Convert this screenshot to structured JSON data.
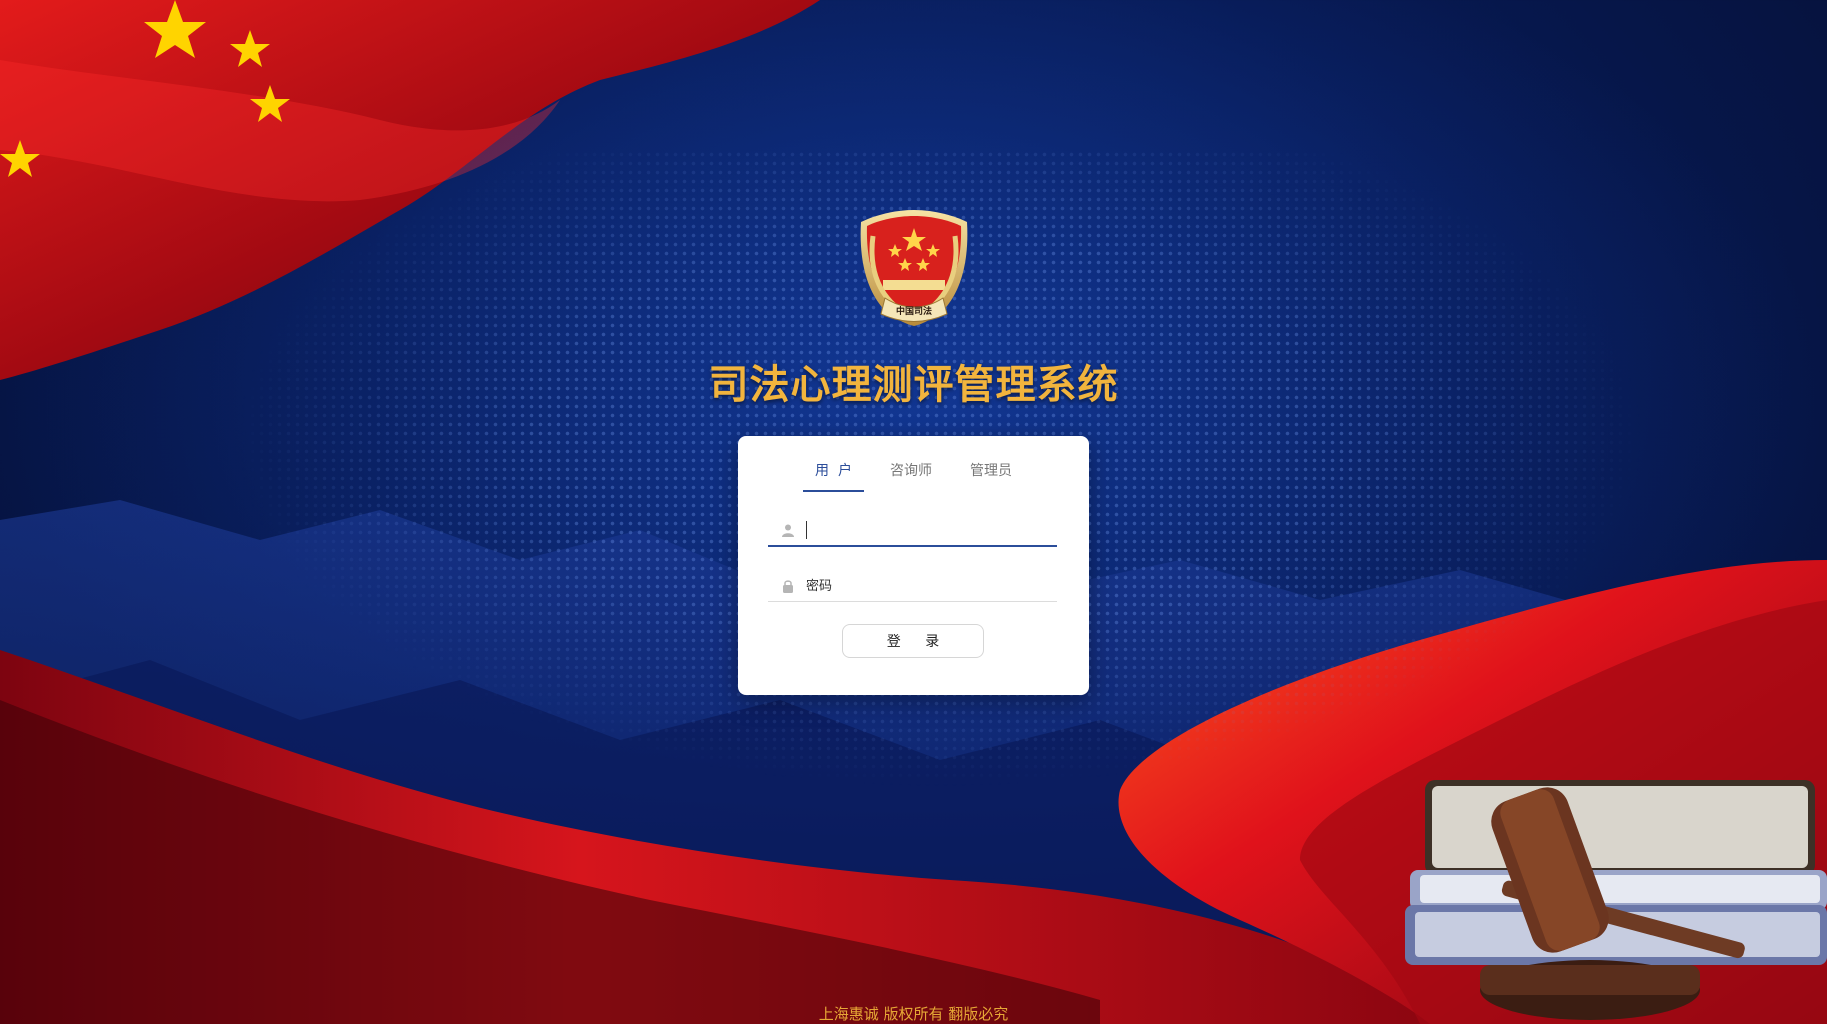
{
  "app": {
    "title": "司法心理测评管理系统",
    "emblem_text": "中国司法"
  },
  "login": {
    "tabs": [
      {
        "label": "用  户",
        "active": true
      },
      {
        "label": "咨询师",
        "active": false
      },
      {
        "label": "管理员",
        "active": false
      }
    ],
    "username": {
      "value": "",
      "placeholder": "",
      "icon": "user-icon"
    },
    "password": {
      "placeholder": "密码",
      "icon": "lock-icon"
    },
    "submit_label": "登 录"
  },
  "footer": {
    "text": "上海惠诚 版权所有 翻版必究"
  },
  "colors": {
    "accent": "#2b4d9a",
    "title": "#f2b43d",
    "footer": "#e6a736",
    "background": "#071a55",
    "flag_red": "#c8101a"
  }
}
